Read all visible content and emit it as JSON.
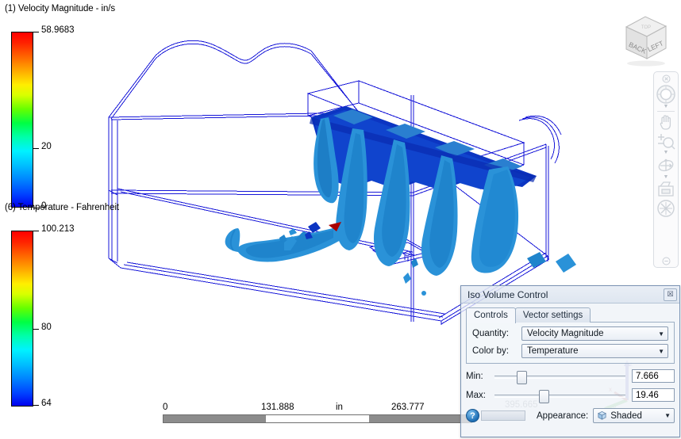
{
  "legends": [
    {
      "id": "velocity",
      "title": "(1) Velocity Magnitude - in/s",
      "max_label": "58.9683",
      "mid_label": "20",
      "min_label": "0",
      "max_value": 58.9683,
      "mid_value": 20,
      "min_value": 0,
      "mid_position_pct": 66.1,
      "colors": [
        "#ff0000",
        "#ffaa00",
        "#ffee00",
        "#00ff44",
        "#00f2ff",
        "#0080ff",
        "#0000ee"
      ]
    },
    {
      "id": "temperature",
      "title": "(6) Temperature - Fahrenheit",
      "max_label": "100.213",
      "mid_label": "80",
      "min_label": "64",
      "max_value": 100.213,
      "mid_value": 80,
      "min_value": 64,
      "mid_position_pct": 55.7,
      "colors": [
        "#ff0000",
        "#ffaa00",
        "#ffee00",
        "#00ff44",
        "#00f2ff",
        "#0080ff",
        "#0000ee"
      ]
    }
  ],
  "view_cube": {
    "face_front_label": "BACK",
    "face_right_label": "LEFT",
    "face_top_label": "TOP"
  },
  "nav_bar": {
    "close_label": "×",
    "items": [
      {
        "name": "steering-wheel-icon",
        "label": "Full Navigation Wheel"
      },
      {
        "name": "pan-hand-icon",
        "label": "Pan"
      },
      {
        "name": "zoom-magnifier-icon",
        "label": "Zoom"
      },
      {
        "name": "orbit-icon",
        "label": "Orbit"
      },
      {
        "name": "look-camera-icon",
        "label": "Look"
      },
      {
        "name": "fit-all-icon",
        "label": "Fit All"
      }
    ],
    "minimize_label": "−"
  },
  "scale_ruler": {
    "unit": "in",
    "ticks": [
      "0",
      "131.888",
      "263.777"
    ],
    "far_label": "395.665",
    "segments": [
      "dark",
      "light",
      "dark"
    ]
  },
  "dialog": {
    "title": "Iso Volume Control",
    "close_label": "☒",
    "tabs": [
      {
        "label": "Controls",
        "active": true
      },
      {
        "label": "Vector settings",
        "active": false
      }
    ],
    "fields": [
      {
        "label": "Quantity:",
        "value": "Velocity Magnitude"
      },
      {
        "label": "Color by:",
        "value": "Temperature"
      }
    ],
    "sliders": [
      {
        "label": "Min:",
        "value": "7.666",
        "handle_pct": 17
      },
      {
        "label": "Max:",
        "value": "19.46",
        "handle_pct": 34
      }
    ],
    "appearance": {
      "label": "Appearance:",
      "value": "Shaded"
    },
    "help_label": "?"
  },
  "colors": {
    "wireframe": "#1616d8",
    "iso_light": "#2a92d8",
    "iso_mid": "#1573c4",
    "iso_dark": "#0b3fc0",
    "iso_deep": "#0a1fb4",
    "hot_spot": "#aa0000",
    "background": "#ffffff"
  }
}
